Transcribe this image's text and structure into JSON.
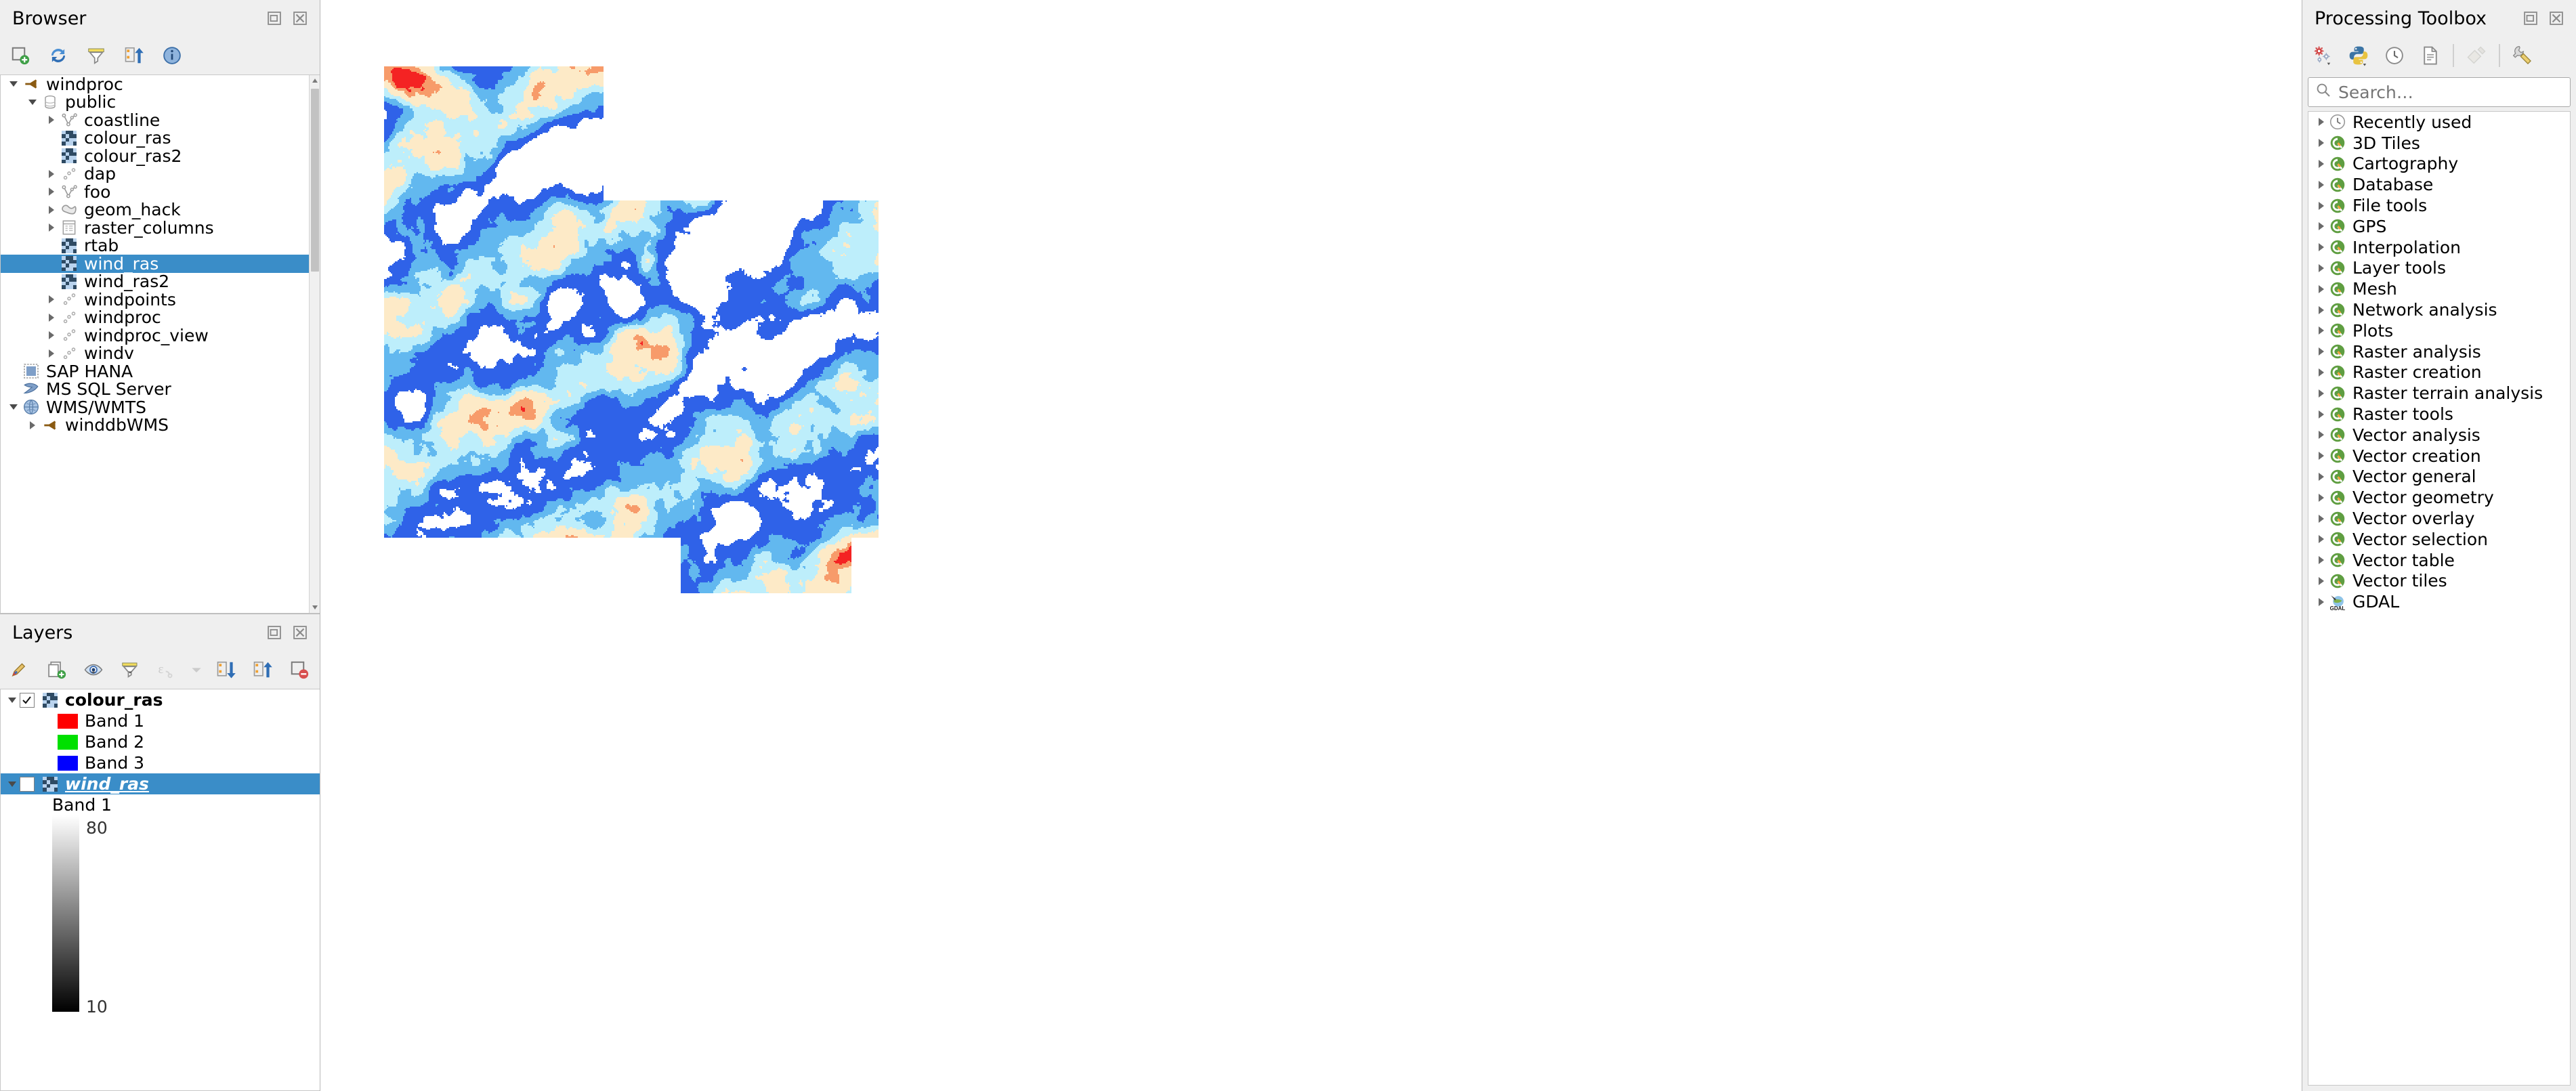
{
  "browser": {
    "title": "Browser",
    "toolbar": [
      {
        "name": "add-layer-icon",
        "title": "Add Layer"
      },
      {
        "name": "refresh-icon",
        "title": "Refresh"
      },
      {
        "name": "filter-icon",
        "title": "Filter Browser"
      },
      {
        "name": "collapse-all-icon",
        "title": "Collapse All"
      },
      {
        "name": "properties-info-icon",
        "title": "Properties"
      }
    ],
    "items": [
      {
        "label": "windproc",
        "indent": 0,
        "arrow": "down",
        "icon": "postgres-icon"
      },
      {
        "label": "public",
        "indent": 1,
        "arrow": "down",
        "icon": "schema-icon"
      },
      {
        "label": "coastline",
        "indent": 2,
        "arrow": "right",
        "icon": "line-layer-icon"
      },
      {
        "label": "colour_ras",
        "indent": 2,
        "arrow": "none",
        "icon": "raster-layer-icon"
      },
      {
        "label": "colour_ras2",
        "indent": 2,
        "arrow": "none",
        "icon": "raster-layer-icon"
      },
      {
        "label": "dap",
        "indent": 2,
        "arrow": "right",
        "icon": "point-layer-icon"
      },
      {
        "label": "foo",
        "indent": 2,
        "arrow": "right",
        "icon": "line-layer-icon"
      },
      {
        "label": "geom_hack",
        "indent": 2,
        "arrow": "right",
        "icon": "polygon-layer-icon"
      },
      {
        "label": "raster_columns",
        "indent": 2,
        "arrow": "right",
        "icon": "table-icon"
      },
      {
        "label": "rtab",
        "indent": 2,
        "arrow": "none",
        "icon": "raster-layer-icon"
      },
      {
        "label": "wind_ras",
        "indent": 2,
        "arrow": "none",
        "icon": "raster-layer-icon",
        "selected": true
      },
      {
        "label": "wind_ras2",
        "indent": 2,
        "arrow": "none",
        "icon": "raster-layer-icon"
      },
      {
        "label": "windpoints",
        "indent": 2,
        "arrow": "right",
        "icon": "point-layer-icon"
      },
      {
        "label": "windproc",
        "indent": 2,
        "arrow": "right",
        "icon": "point-layer-icon"
      },
      {
        "label": "windproc_view",
        "indent": 2,
        "arrow": "right",
        "icon": "point-layer-icon"
      },
      {
        "label": "windv",
        "indent": 2,
        "arrow": "right",
        "icon": "point-layer-icon"
      },
      {
        "label": "SAP HANA",
        "indent": 0,
        "arrow": "none",
        "icon": "sap-hana-icon"
      },
      {
        "label": "MS SQL Server",
        "indent": 0,
        "arrow": "none",
        "icon": "mssql-icon"
      },
      {
        "label": "WMS/WMTS",
        "indent": 0,
        "arrow": "down",
        "icon": "globe-icon"
      },
      {
        "label": "winddbWMS",
        "indent": 1,
        "arrow": "right",
        "icon": "postgres-icon"
      }
    ]
  },
  "layers": {
    "title": "Layers",
    "toolbar": [
      {
        "name": "open-layer-styling-panel-icon",
        "title": "Open the Layer Styling panel"
      },
      {
        "name": "add-group-icon",
        "title": "Add Group"
      },
      {
        "name": "manage-map-themes-icon",
        "title": "Manage Map Themes"
      },
      {
        "name": "filter-legend-icon",
        "title": "Filter Legend"
      },
      {
        "name": "edit-expression-filter-icon",
        "title": "Filter Legend by Expression"
      },
      {
        "name": "expand-all-icon",
        "title": "Expand All"
      },
      {
        "name": "collapse-all-icon",
        "title": "Collapse All"
      },
      {
        "name": "remove-layer-icon",
        "title": "Remove Layer/Group"
      }
    ],
    "tree": [
      {
        "name": "colour_ras",
        "type": "layer",
        "checked": true,
        "expanded": true,
        "icon": "raster-layer-icon",
        "selected": false
      },
      {
        "name": "Band 1",
        "type": "band",
        "swatch": "#ff0000"
      },
      {
        "name": "Band 2",
        "type": "band",
        "swatch": "#00e000"
      },
      {
        "name": "Band 3",
        "type": "band",
        "swatch": "#0000ff"
      },
      {
        "name": "wind_ras",
        "type": "layer",
        "checked": false,
        "expanded": true,
        "icon": "raster-layer-icon",
        "selected": true
      },
      {
        "name": "Band 1",
        "type": "band-label"
      }
    ],
    "ramp": {
      "max_label": "80",
      "min_label": "10",
      "top_color": "#ffffff",
      "bottom_color": "#000000"
    }
  },
  "processing": {
    "title": "Processing Toolbox",
    "toolbar": [
      {
        "name": "models-icon",
        "title": "Models"
      },
      {
        "name": "python-scripts-icon",
        "title": "Scripts"
      },
      {
        "name": "history-icon",
        "title": "History"
      },
      {
        "name": "results-viewer-icon",
        "title": "Results Viewer"
      },
      {
        "name": "edit-rendering-icon",
        "title": "Edit features in-place"
      },
      {
        "name": "options-wrench-icon",
        "title": "Options"
      }
    ],
    "search": {
      "placeholder": "Search…",
      "value": ""
    },
    "items": [
      {
        "label": "Recently used",
        "icon": "clock-icon"
      },
      {
        "label": "3D Tiles",
        "icon": "qgis-icon"
      },
      {
        "label": "Cartography",
        "icon": "qgis-icon"
      },
      {
        "label": "Database",
        "icon": "qgis-icon"
      },
      {
        "label": "File tools",
        "icon": "qgis-icon"
      },
      {
        "label": "GPS",
        "icon": "qgis-icon"
      },
      {
        "label": "Interpolation",
        "icon": "qgis-icon"
      },
      {
        "label": "Layer tools",
        "icon": "qgis-icon"
      },
      {
        "label": "Mesh",
        "icon": "qgis-icon"
      },
      {
        "label": "Network analysis",
        "icon": "qgis-icon"
      },
      {
        "label": "Plots",
        "icon": "qgis-icon"
      },
      {
        "label": "Raster analysis",
        "icon": "qgis-icon"
      },
      {
        "label": "Raster creation",
        "icon": "qgis-icon"
      },
      {
        "label": "Raster terrain analysis",
        "icon": "qgis-icon"
      },
      {
        "label": "Raster tools",
        "icon": "qgis-icon"
      },
      {
        "label": "Vector analysis",
        "icon": "qgis-icon"
      },
      {
        "label": "Vector creation",
        "icon": "qgis-icon"
      },
      {
        "label": "Vector general",
        "icon": "qgis-icon"
      },
      {
        "label": "Vector geometry",
        "icon": "qgis-icon"
      },
      {
        "label": "Vector overlay",
        "icon": "qgis-icon"
      },
      {
        "label": "Vector selection",
        "icon": "qgis-icon"
      },
      {
        "label": "Vector table",
        "icon": "qgis-icon"
      },
      {
        "label": "Vector tiles",
        "icon": "qgis-icon"
      },
      {
        "label": "GDAL",
        "icon": "gdal-icon"
      }
    ]
  },
  "map": {
    "name": "map-canvas",
    "background": "#ffffff",
    "raster_palette": [
      "#ffffff",
      "#2f62e8",
      "#62b8ef",
      "#bdeefb",
      "#fdeac7",
      "#f79b6a",
      "#f42323"
    ]
  }
}
